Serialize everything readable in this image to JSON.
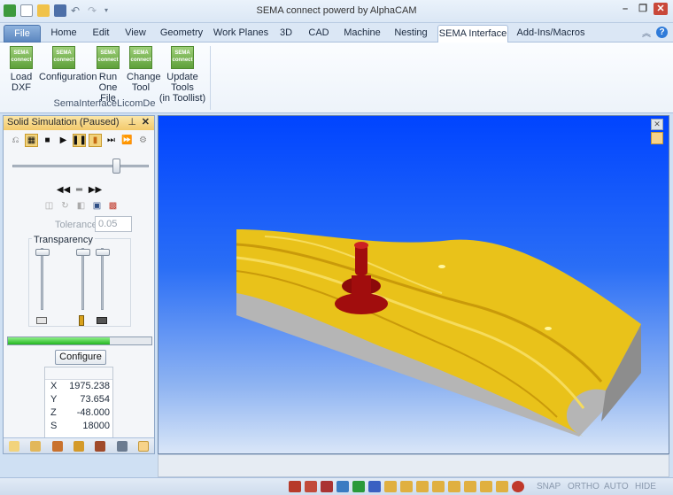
{
  "window": {
    "title": "SEMA connect powerd by AlphaCAM"
  },
  "tabs": [
    {
      "label": "File"
    },
    {
      "label": "Home"
    },
    {
      "label": "Edit"
    },
    {
      "label": "View"
    },
    {
      "label": "Geometry"
    },
    {
      "label": "Work Planes"
    },
    {
      "label": "3D"
    },
    {
      "label": "CAD"
    },
    {
      "label": "Machine"
    },
    {
      "label": "Nesting"
    },
    {
      "label": "SEMA Interface"
    },
    {
      "label": "Add-Ins/Macros"
    }
  ],
  "ribbon": {
    "buttons": [
      {
        "line1": "Load",
        "line2": "DXF",
        "icon": "sema-connect-icon"
      },
      {
        "line1": "Configuration",
        "line2": "",
        "icon": "sema-connect-icon"
      },
      {
        "line1": "Run One",
        "line2": "File",
        "icon": "sema-connect-icon"
      },
      {
        "line1": "Change",
        "line2": "Tool",
        "icon": "sema-connect-icon"
      },
      {
        "line1": "Update Tools",
        "line2": "(in Toollist)",
        "icon": "sema-connect-icon"
      }
    ],
    "sema_logo": {
      "line1": "SEMA",
      "line2": "connect"
    },
    "group_label": "SemaInterfaceLicomDe"
  },
  "panel": {
    "title": "Solid Simulation (Paused)",
    "position_slider_fraction": 0.77,
    "tolerance_label": "Tolerance",
    "tolerance_value": "0.05",
    "transparency_label": "Transparency",
    "transparency_levels": [
      0,
      0,
      0
    ],
    "progress_fraction": 0.71,
    "configure_label": "Configure",
    "coords": [
      {
        "axis": "X",
        "value": "1975.238"
      },
      {
        "axis": "Y",
        "value": "73.654"
      },
      {
        "axis": "Z",
        "value": "-48.000"
      },
      {
        "axis": "S",
        "value": "18000"
      }
    ]
  },
  "status": {
    "snap": "SNAP",
    "ortho": "ORTHO",
    "auto": "AUTO",
    "hide": "HIDE"
  },
  "colors": {
    "accent": "#2b579a",
    "viewport_top": "#0044ff",
    "part": "#e9c21a",
    "tool": "#a10d0d",
    "progress": "#23b51f"
  }
}
